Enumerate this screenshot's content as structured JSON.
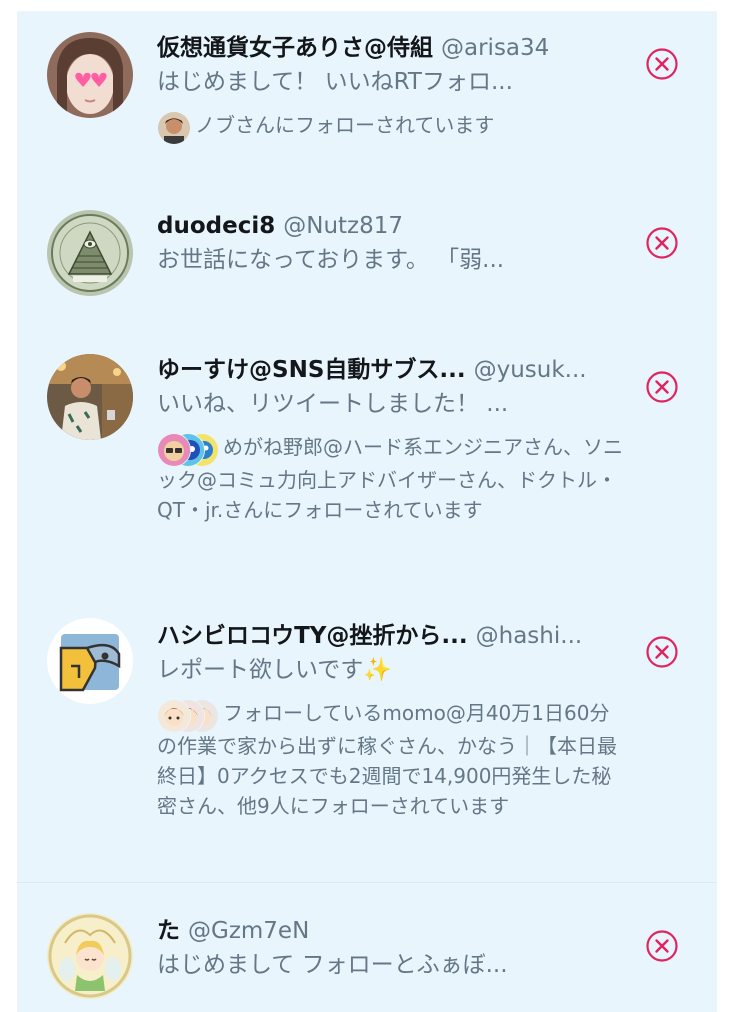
{
  "accounts": [
    {
      "name": "仮想通貨女子ありさ@侍組",
      "handle": "@arisa34",
      "bio": "はじめまして！ いいねRTフォロ...",
      "followed_by": "ノブさんにフォローされています",
      "avatar_icon": "woman-with-heart-sunglasses-avatar"
    },
    {
      "name": "duodeci8",
      "handle": "@Nutz817",
      "bio": "お世話になっております。 「弱...",
      "avatar_icon": "pyramid-eye-seal-avatar"
    },
    {
      "name": "ゆーすけ@SNS自動サブス...",
      "handle": "@yusuk...",
      "bio": "いいね、リツイートしました！ ...",
      "followed_by": "めがね野郎@ハード系エンジニアさん、ソニック@コミュ力向上アドバイザーさん、ドクトル・QT・jr.さんにフォローされています",
      "avatar_icon": "man-in-cafe-avatar"
    },
    {
      "name": "ハシビロコウTY@挫折から...",
      "handle": "@hashi...",
      "bio": "レポート欲しいです",
      "bio_emoji": "✨",
      "followed_by": "フォローしているmomo@月40万1日60分の作業で家から出ずに稼ぐさん、かなう｜【本日最終日】0アクセスでも2週間で14,900円発生した秘密さん、他9人にフォローされています",
      "avatar_icon": "shoebill-bird-avatar"
    },
    {
      "name": "た",
      "handle": "@Gzm7eN",
      "bio": "はじめまして フォローとふぁぼ...",
      "avatar_icon": "fairy-illustration-avatar"
    }
  ],
  "colors": {
    "panel_bg": "#e8f5fd",
    "name_text": "#14171a",
    "secondary_text": "#657786",
    "dismiss_red": "#e0245e"
  },
  "dismiss_icon": "x-circle-icon"
}
